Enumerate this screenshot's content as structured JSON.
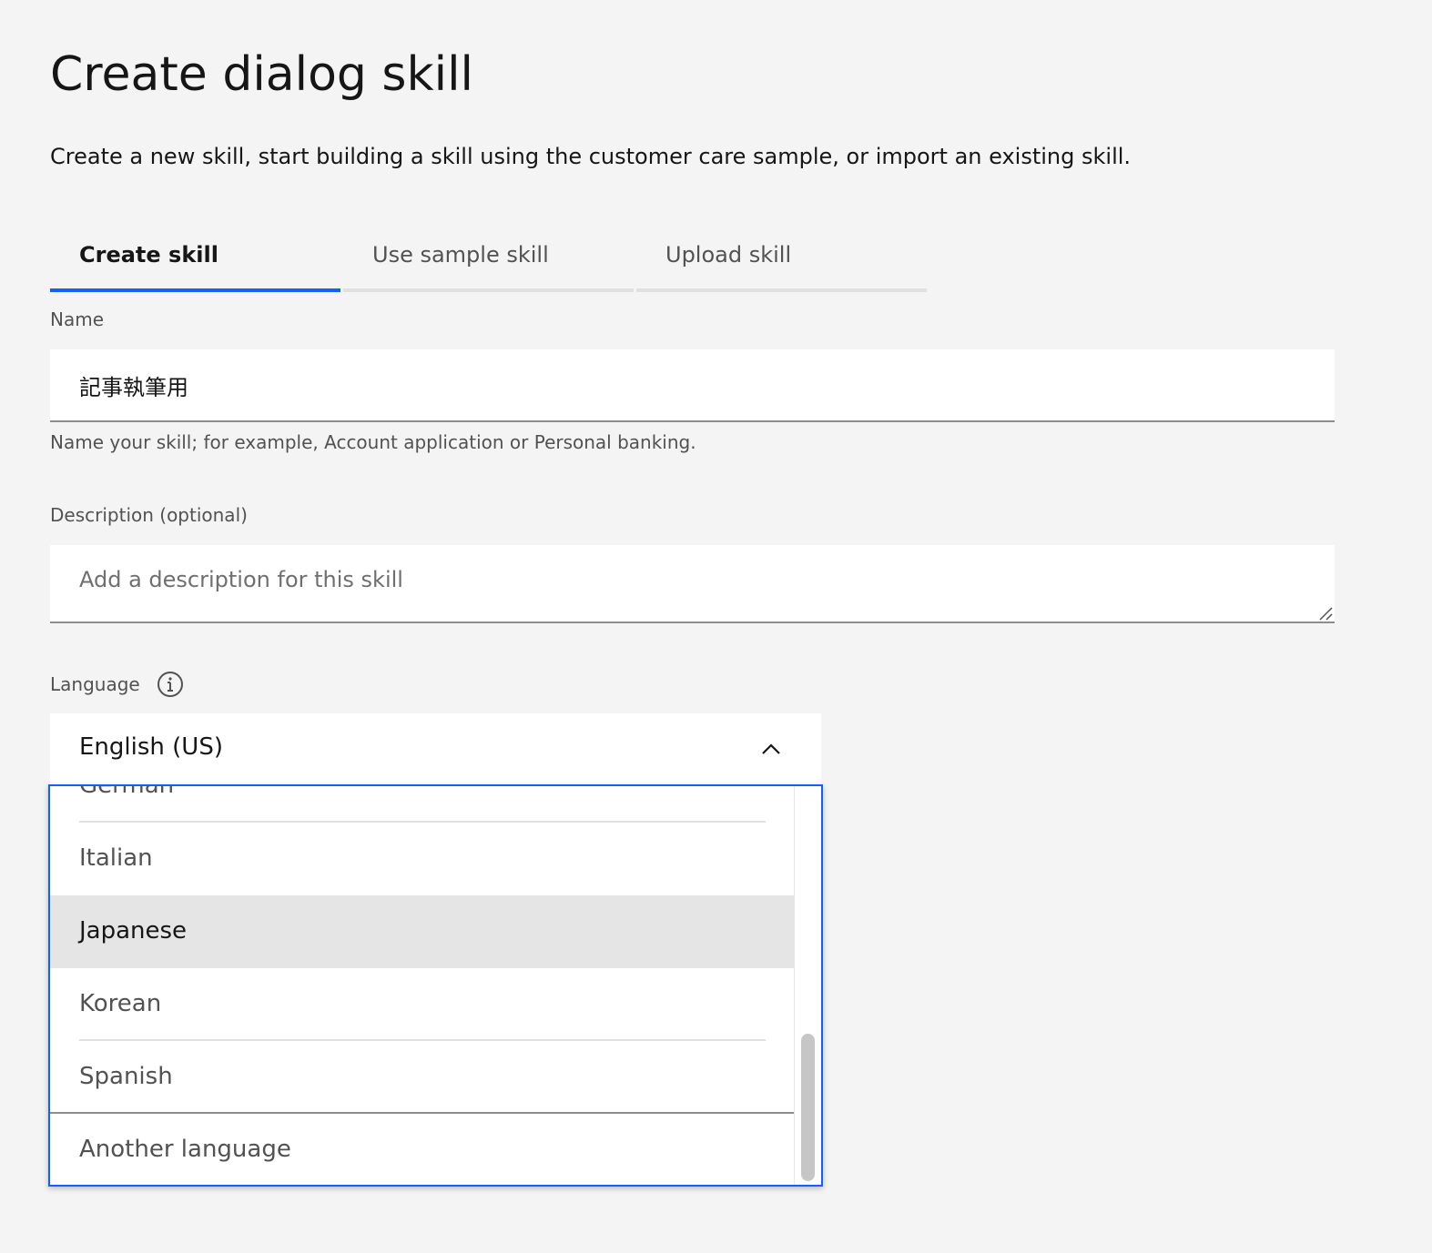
{
  "page": {
    "title": "Create dialog skill",
    "description": "Create a new skill, start building a skill using the customer care sample, or import an existing skill."
  },
  "tabs": [
    {
      "label": "Create skill",
      "active": true
    },
    {
      "label": "Use sample skill",
      "active": false
    },
    {
      "label": "Upload skill",
      "active": false
    }
  ],
  "name_field": {
    "label": "Name",
    "value": "記事執筆用",
    "helper": "Name your skill; for example, Account application or Personal banking."
  },
  "description_field": {
    "label": "Description (optional)",
    "value": "",
    "placeholder": "Add a description for this skill"
  },
  "language_field": {
    "label": "Language",
    "info_icon": "info-icon",
    "selected": "English (US)",
    "expanded": true,
    "options": [
      "German",
      "Italian",
      "Japanese",
      "Korean",
      "Spanish",
      "Another language"
    ],
    "hovered_option": "Japanese"
  },
  "colors": {
    "accent": "#0f62fe",
    "background": "#f4f4f4",
    "field": "#ffffff",
    "hover": "#e5e5e5"
  }
}
